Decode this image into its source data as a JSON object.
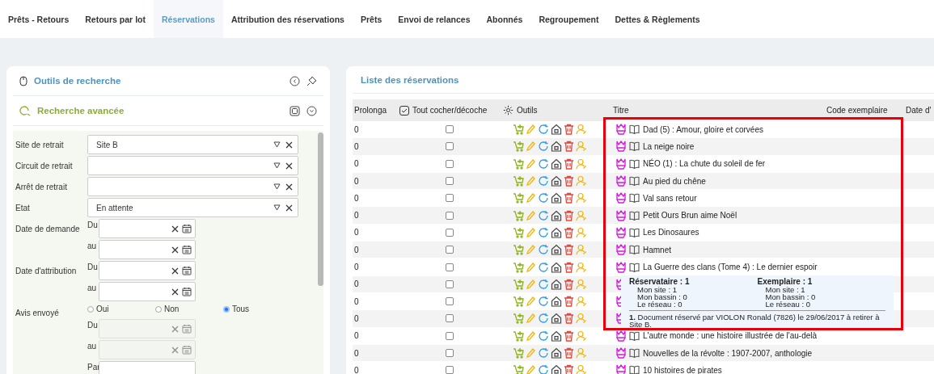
{
  "tabs": [
    {
      "label": "Prêts - Retours",
      "selected": false
    },
    {
      "label": "Retours par lot",
      "selected": false
    },
    {
      "label": "Réservations",
      "selected": true
    },
    {
      "label": "Attribution des réservations",
      "selected": false
    },
    {
      "label": "Prêts",
      "selected": false
    },
    {
      "label": "Envoi de relances",
      "selected": false
    },
    {
      "label": "Abonnés",
      "selected": false
    },
    {
      "label": "Regroupement",
      "selected": false
    },
    {
      "label": "Dettes & Règlements",
      "selected": false
    }
  ],
  "search_panel": {
    "title": "Outils de recherche",
    "advanced_title": "Recherche avancée",
    "filters": [
      {
        "kind": "select",
        "label": "Site de retrait",
        "value": "Site B"
      },
      {
        "kind": "select",
        "label": "Circuit de retrait"
      },
      {
        "kind": "select",
        "label": "Arrêt de retrait"
      },
      {
        "kind": "select",
        "label": "Etat",
        "value": "En attente"
      },
      {
        "kind": "date",
        "label": "Date de demande",
        "prefix": "Du",
        "disabled": false
      },
      {
        "kind": "date",
        "prefix": "au",
        "disabled": false
      },
      {
        "kind": "date",
        "label": "Date d'attribution",
        "prefix": "Du",
        "disabled": false
      },
      {
        "kind": "date",
        "prefix": "au",
        "disabled": false
      },
      {
        "kind": "radios",
        "label": "Avis envoyé",
        "options": [
          {
            "label": "Oui",
            "selected": false
          },
          {
            "label": "Non",
            "selected": false
          },
          {
            "label": "Tous",
            "selected": true
          }
        ]
      },
      {
        "kind": "date",
        "prefix": "Du",
        "disabled": true
      },
      {
        "kind": "date",
        "prefix": "au",
        "disabled": true
      },
      {
        "kind": "field",
        "prefix": "Par"
      }
    ]
  },
  "reservations": {
    "title": "Liste des réservations",
    "columns": [
      "Prolonga",
      "Tout cocher/décoche",
      "Outils",
      "Titre",
      "Code exemplaire",
      "Date d'"
    ],
    "rows": [
      {
        "prolonga": "0",
        "checked": false,
        "title": "Dad (5) : Amour, gloire et corvées"
      },
      {
        "prolonga": "0",
        "checked": false,
        "title": "La neige noire"
      },
      {
        "prolonga": "0",
        "checked": false,
        "title": "NÉO (1) : La chute du soleil de fer"
      },
      {
        "prolonga": "0",
        "checked": false,
        "title": "Au pied du chêne"
      },
      {
        "prolonga": "0",
        "checked": false,
        "title": "Val sans retour"
      },
      {
        "prolonga": "0",
        "checked": false,
        "title": "Petit Ours Brun aime Noël"
      },
      {
        "prolonga": "0",
        "checked": false,
        "title": "Les Dinosaures"
      },
      {
        "prolonga": "0",
        "checked": false,
        "title": "Hamnet"
      },
      {
        "prolonga": "0",
        "checked": false,
        "title": "La Guerre des clans (Tome 4) : Le dernier espoir"
      },
      {
        "prolonga": "0",
        "checked": false
      },
      {
        "prolonga": "0",
        "checked": false
      },
      {
        "prolonga": "0",
        "checked": false
      },
      {
        "prolonga": "0",
        "checked": false,
        "title": "L'autre monde : une histoire illustrée de l'au-delà"
      },
      {
        "prolonga": "0",
        "checked": false,
        "title": "Nouvelles de la révolte : 1907-2007, anthologie"
      },
      {
        "prolonga": "0",
        "checked": false,
        "title": "10 histoires de pirates"
      }
    ],
    "tooltip": {
      "reservataire": {
        "heading": "Réservataire : 1",
        "lines": [
          "Mon site : 1",
          "Mon bassin : 0",
          "Le réseau : 0"
        ]
      },
      "exemplaire": {
        "heading": "Exemplaire : 1",
        "lines": [
          "Mon site : 1",
          "Mon bassin : 0",
          "Le réseau : 0"
        ]
      },
      "note": "**1.** Document réservé par VIOLON Ronald (7826) le 29/06/2017 à retirer à Site B."
    }
  }
}
